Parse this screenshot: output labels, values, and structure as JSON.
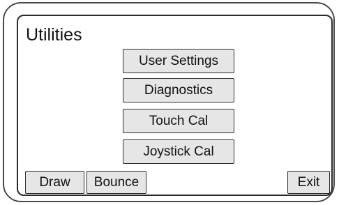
{
  "screen": {
    "title": "Utilities"
  },
  "menu": {
    "user_settings_label": "User Settings",
    "diagnostics_label": "Diagnostics",
    "touch_cal_label": "Touch Cal",
    "joystick_cal_label": "Joystick Cal"
  },
  "footer": {
    "draw_label": "Draw",
    "bounce_label": "Bounce",
    "exit_label": "Exit"
  },
  "colors": {
    "button_fill": "#e6e6e6",
    "border": "#2e2e2e",
    "background": "#ffffff",
    "text": "#111111"
  }
}
